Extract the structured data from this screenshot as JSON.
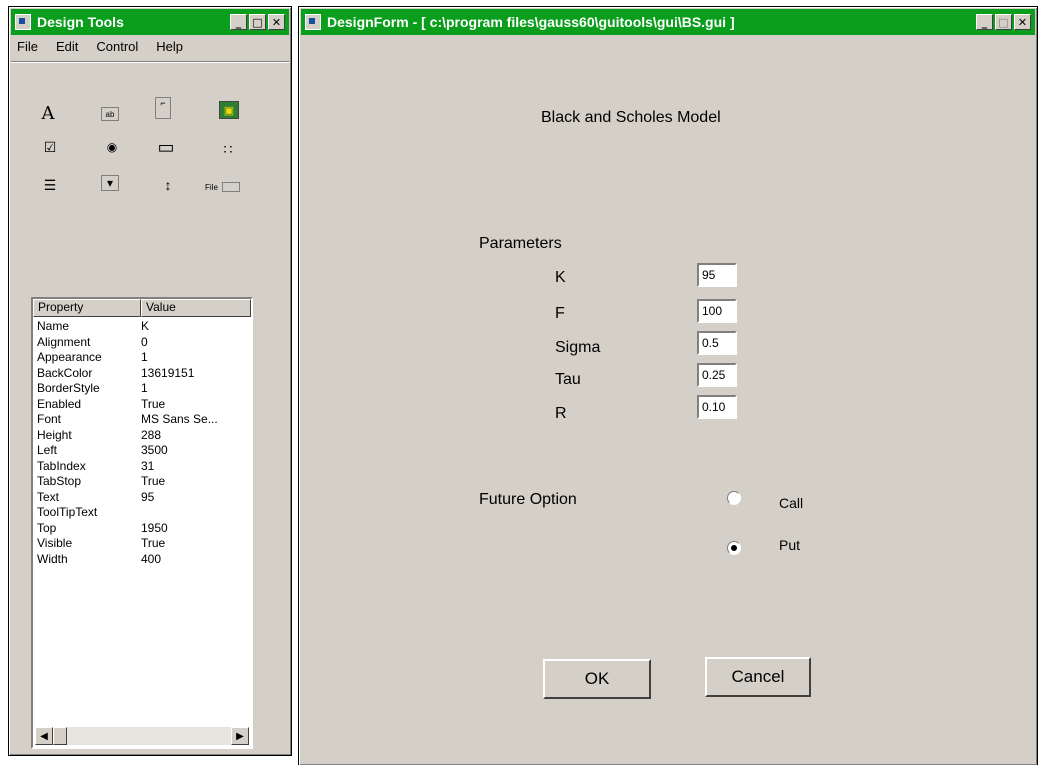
{
  "design_tools": {
    "title": "Design Tools",
    "menu": [
      "File",
      "Edit",
      "Control",
      "Help"
    ],
    "toolbox": [
      {
        "name": "label-tool-icon",
        "glyph": "A"
      },
      {
        "name": "textbox-tool-icon",
        "glyph": "ab"
      },
      {
        "name": "frame-tool-icon",
        "glyph": "⌐"
      },
      {
        "name": "image-tool-icon",
        "glyph": "▣"
      },
      {
        "name": "checkbox-tool-icon",
        "glyph": "☑"
      },
      {
        "name": "radio-tool-icon",
        "glyph": "◉"
      },
      {
        "name": "button-tool-icon",
        "glyph": "▭"
      },
      {
        "name": "listbox-tool-icon",
        "glyph": "∷"
      },
      {
        "name": "combo-tool-icon",
        "glyph": "☰"
      },
      {
        "name": "dropdown-tool-icon",
        "glyph": "▾"
      },
      {
        "name": "spinner-tool-icon",
        "glyph": "↕"
      },
      {
        "name": "file-tool-icon",
        "glyph": "File"
      }
    ],
    "property_header": {
      "property": "Property",
      "value": "Value"
    },
    "properties": [
      {
        "name": "Name",
        "value": "K"
      },
      {
        "name": "Alignment",
        "value": "0"
      },
      {
        "name": "Appearance",
        "value": "1"
      },
      {
        "name": "BackColor",
        "value": "13619151"
      },
      {
        "name": "BorderStyle",
        "value": "1"
      },
      {
        "name": "Enabled",
        "value": "True"
      },
      {
        "name": "Font",
        "value": "MS Sans Se..."
      },
      {
        "name": "Height",
        "value": "288"
      },
      {
        "name": "Left",
        "value": "3500"
      },
      {
        "name": "TabIndex",
        "value": "31"
      },
      {
        "name": "TabStop",
        "value": "True"
      },
      {
        "name": "Text",
        "value": "95"
      },
      {
        "name": "ToolTipText",
        "value": ""
      },
      {
        "name": "Top",
        "value": "1950"
      },
      {
        "name": "Visible",
        "value": "True"
      },
      {
        "name": "Width",
        "value": "400"
      }
    ]
  },
  "design_form": {
    "title": "DesignForm - [ c:\\program files\\gauss60\\guitools\\gui\\BS.gui ]",
    "heading": "Black and Scholes Model",
    "params_label": "Parameters",
    "params": [
      {
        "label": "K",
        "value": "95"
      },
      {
        "label": "F",
        "value": "100"
      },
      {
        "label": "Sigma",
        "value": "0.5"
      },
      {
        "label": "Tau",
        "value": "0.25"
      },
      {
        "label": "R",
        "value": "0.10"
      }
    ],
    "option_label": "Future Option",
    "options": [
      {
        "label": "Call",
        "selected": false
      },
      {
        "label": "Put",
        "selected": true
      }
    ],
    "ok_label": "OK",
    "cancel_label": "Cancel"
  },
  "window_buttons": {
    "minimize": "_",
    "maximize": "□",
    "close": "✕"
  },
  "colors": {
    "titlebar": "#0a9e1c",
    "face": "#d4d0c8"
  }
}
